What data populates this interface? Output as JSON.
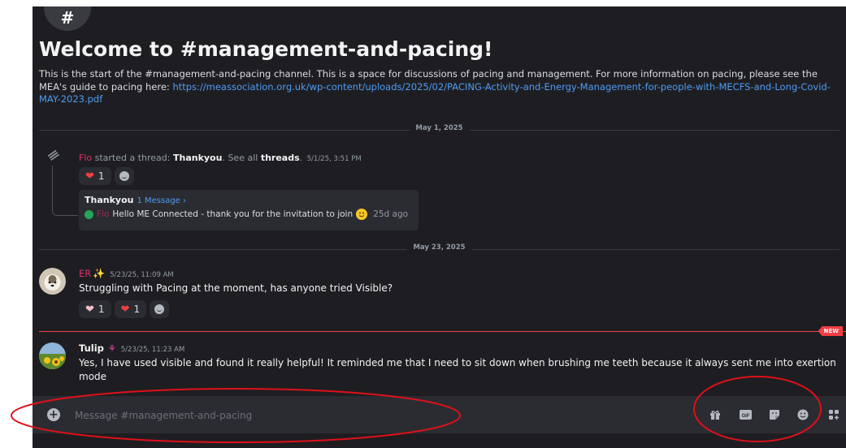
{
  "channel": {
    "hash_symbol": "#",
    "welcome_title": "Welcome to #management-and-pacing!",
    "description_text": "This is the start of the #management-and-pacing channel. This is a space for discussions of pacing and management. For more information on pacing, please see the MEA's guide to pacing here: ",
    "description_link": "https://meassociation.org.uk/wp-content/uploads/2025/02/PACING-Activity-and-Energy-Management-for-people-with-MECFS-and-Long-Covid-MAY-2023.pdf"
  },
  "dividers": [
    "May 1, 2025",
    "May 23, 2025"
  ],
  "thread_event": {
    "user": "Flo",
    "text1": " started a thread: ",
    "thread_name": "Thankyou",
    "text2": ". See all ",
    "threads_link": "threads",
    "text3": ".",
    "timestamp": "5/1/25, 3:51 PM",
    "reactions": [
      {
        "emoji": "red-heart",
        "count": "1"
      },
      {
        "emoji": "add-reaction",
        "count": ""
      }
    ],
    "card": {
      "title": "Thankyou",
      "message_count": "1 Message ›",
      "preview_user": "Flo",
      "preview_text": "Hello ME Connected - thank you for the invitation to join",
      "preview_emoji": "slightly-smiling-face",
      "ago": "25d ago"
    }
  },
  "messages": [
    {
      "author": "ER",
      "author_emoji": "sparkles",
      "author_color": "#e0306c",
      "timestamp": "5/23/25, 11:09 AM",
      "text": "Struggling with Pacing at the moment, has anyone tried Visible?",
      "reactions": [
        {
          "emoji": "pink-heart",
          "count": "1"
        },
        {
          "emoji": "red-heart",
          "count": "1"
        },
        {
          "emoji": "add-reaction",
          "count": ""
        }
      ]
    },
    {
      "author": "Tulip",
      "author_emoji": "tulip",
      "author_color": "#f2f3f5",
      "timestamp": "5/23/25, 11:23 AM",
      "text": "Yes, I have used visible and found it really helpful! It reminded me that I need to sit down when brushing me teeth because it always sent me into exertion mode"
    }
  ],
  "new_badge": "NEW",
  "composer": {
    "placeholder": "Message #management-and-pacing",
    "tools": [
      "gift-icon",
      "gif-icon",
      "sticker-icon",
      "emoji-icon",
      "apps-icon"
    ],
    "gif_label": "GIF"
  },
  "colors": {
    "background": "#1e1e22",
    "composer": "#2b2c31",
    "link": "#4f9cf3",
    "mention_pink": "#e0306c",
    "new_red": "#f23f43",
    "annotation_red": "#e0101a"
  }
}
